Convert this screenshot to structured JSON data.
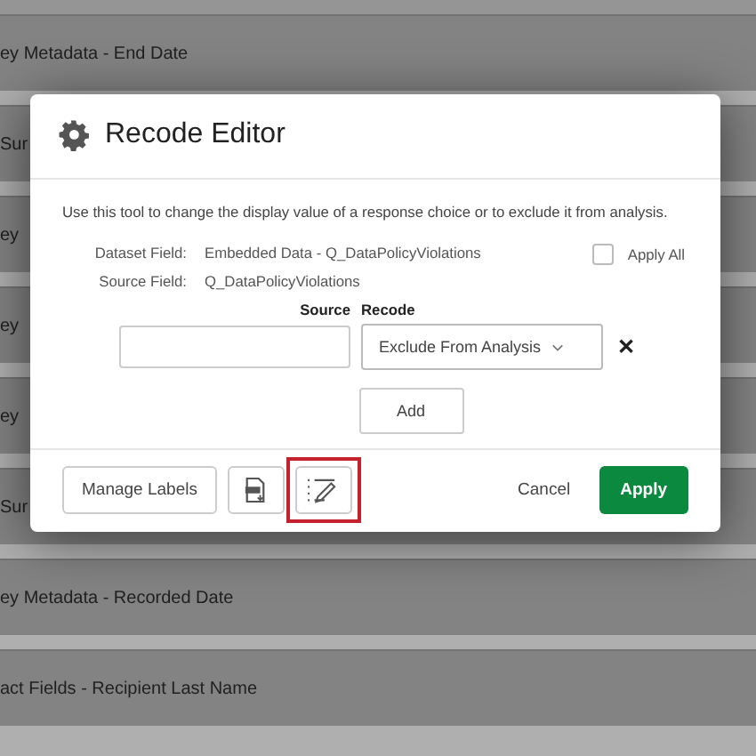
{
  "background_rows": [
    {
      "label": "ey Metadata - End Date"
    },
    {
      "label": "Sur"
    },
    {
      "label": "ey"
    },
    {
      "label": "ey"
    },
    {
      "label": "ey"
    },
    {
      "label": "Sur"
    },
    {
      "label": "ey Metadata - Recorded Date"
    },
    {
      "label": "act Fields - Recipient Last Name"
    }
  ],
  "dialog": {
    "title": "Recode Editor",
    "description": "Use this tool to change the display value of a response choice or to exclude it from analysis.",
    "fields": [
      {
        "label": "Dataset Field:",
        "value": "Embedded Data - Q_DataPolicyViolations"
      },
      {
        "label": "Source Field:",
        "value": "Q_DataPolicyViolations"
      }
    ],
    "apply_all": {
      "label": "Apply All",
      "checked": false
    },
    "columns": [
      "Source",
      "Recode"
    ],
    "recode_rows": [
      {
        "source": "",
        "recode": "Exclude From Analysis",
        "remove": "✕"
      }
    ],
    "add_button": "Add",
    "footer": {
      "manage_labels": "Manage Labels",
      "icon_buttons": [
        {
          "kind": "document",
          "highlighted": false
        },
        {
          "kind": "list-edit",
          "highlighted": true
        }
      ],
      "cancel": "Cancel",
      "apply": "Apply"
    }
  }
}
